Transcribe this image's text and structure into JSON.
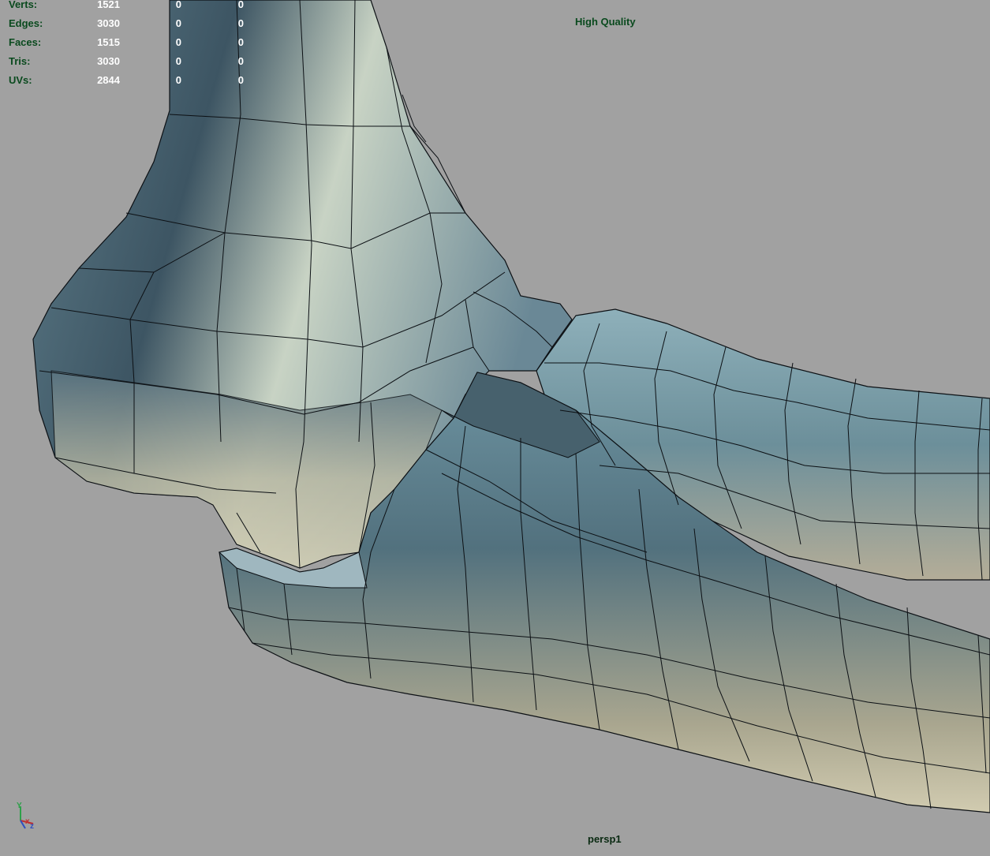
{
  "heads_up_display": {
    "rows": [
      {
        "label": "Verts:",
        "values": [
          "1521",
          "0",
          "0"
        ]
      },
      {
        "label": "Edges:",
        "values": [
          "3030",
          "0",
          "0"
        ]
      },
      {
        "label": "Faces:",
        "values": [
          "1515",
          "0",
          "0"
        ]
      },
      {
        "label": "Tris:",
        "values": [
          "3030",
          "0",
          "0"
        ]
      },
      {
        "label": "UVs:",
        "values": [
          "2844",
          "0",
          "0"
        ]
      }
    ]
  },
  "display_quality": "High Quality",
  "camera": "persp1",
  "axis_gizmo": {
    "x_label": "x",
    "y_label": "Y",
    "z_label": "z"
  },
  "colors": {
    "viewport_background": "#a1a1a1",
    "hud_label": "#0a4a1e",
    "hud_value": "#ffffff",
    "bone_shadow": "#4a6e7c",
    "bone_mid": "#7e9aa3",
    "bone_highlight": "#cdd6c4",
    "wireframe": "#0c1014"
  },
  "icons": [
    "axis-gizmo-icon"
  ]
}
